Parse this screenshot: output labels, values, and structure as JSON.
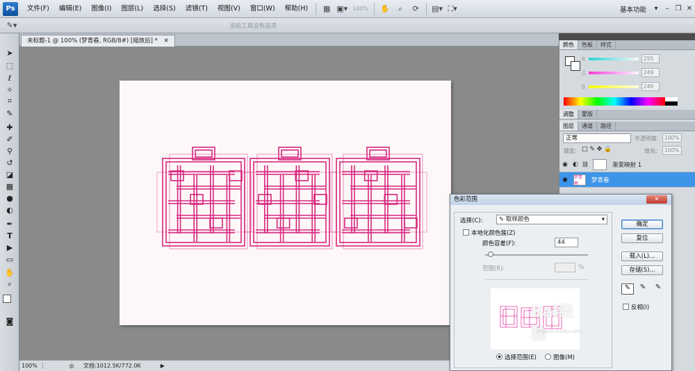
{
  "app": {
    "logo": "Ps",
    "workspace": "基本功能",
    "zoom_display": "100%"
  },
  "menu": [
    "文件(F)",
    "编辑(E)",
    "图像(I)",
    "图层(L)",
    "选择(S)",
    "滤镜(T)",
    "视图(V)",
    "窗口(W)",
    "帮助(H)"
  ],
  "options_bar": {
    "hint": "当前工具没有选项"
  },
  "document": {
    "tab_title": "未标题-1 @ 100% (梦青春, RGB/8#) [缩放后] *",
    "artwork_text": "梦青春"
  },
  "statusbar": {
    "zoom": "100%",
    "doc_info": "文档:1012.5K/772.0K"
  },
  "color_panel": {
    "tabs": [
      "颜色",
      "色板",
      "样式"
    ],
    "r_label": "R",
    "g_label": "G",
    "b_label": "B",
    "r": "255",
    "g": "249",
    "b": "249"
  },
  "adjust_panel": {
    "tabs": [
      "调整",
      "蒙版"
    ]
  },
  "layers_panel": {
    "tabs": [
      "图层",
      "通道",
      "路径"
    ],
    "blend_mode": "正常",
    "opacity_label": "不透明度:",
    "opacity": "100%",
    "lock_label": "锁定:",
    "fill_label": "填充:",
    "fill": "100%",
    "layers": [
      {
        "name": "渐变映射 1",
        "selected": false
      },
      {
        "name": "梦青春",
        "selected": true,
        "thumb": "梦青春"
      }
    ]
  },
  "dialog": {
    "title": "色彩范围",
    "select_label": "选择(C):",
    "select_value": "取样颜色",
    "localized_label": "本地化颜色簇(Z)",
    "tolerance_label": "颜色容差(F):",
    "tolerance": "44",
    "range_label": "范围(R):",
    "range_unit": "%",
    "ok": "确定",
    "reset": "复位",
    "load": "载入(L)...",
    "save": "存储(S)...",
    "invert": "反相(I)",
    "radio_selection": "选择范围(E)",
    "radio_image": "图像(M)"
  },
  "watermark": {
    "text": "Bai经验",
    "url": "jingyan.baidu.com"
  },
  "colors": {
    "magenta": "#d6267e",
    "canvas": "#fdf7f8"
  }
}
